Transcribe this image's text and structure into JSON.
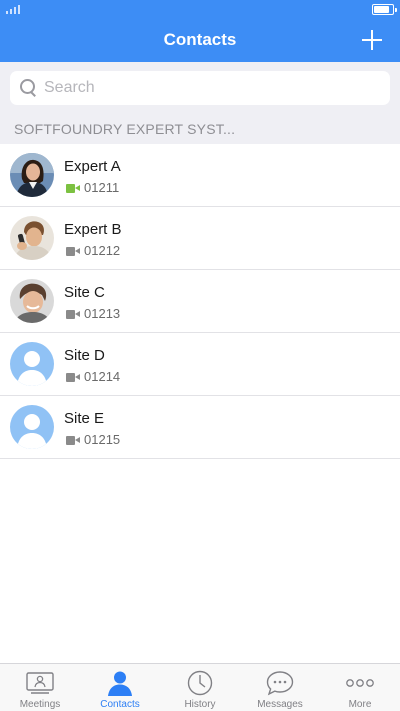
{
  "header": {
    "title": "Contacts",
    "add_icon": "plus-icon",
    "battery_level": 0.85,
    "signal_bars": 4
  },
  "search": {
    "placeholder": "Search",
    "value": ""
  },
  "section": {
    "label": "SOFTFOUNDRY EXPERT SYST..."
  },
  "contacts": [
    {
      "name": "Expert A",
      "number": "01211",
      "avatar": "photo-woman",
      "video_status": "online",
      "status_color": "#7cc141"
    },
    {
      "name": "Expert B",
      "number": "01212",
      "avatar": "photo-man-phone",
      "video_status": "offline",
      "status_color": "#8a8a8a"
    },
    {
      "name": "Site C",
      "number": "01213",
      "avatar": "photo-man-smile",
      "video_status": "offline",
      "status_color": "#8a8a8a"
    },
    {
      "name": "Site D",
      "number": "01214",
      "avatar": "default-person",
      "video_status": "offline",
      "status_color": "#8a8a8a"
    },
    {
      "name": "Site E",
      "number": "01215",
      "avatar": "default-person",
      "video_status": "offline",
      "status_color": "#8a8a8a"
    }
  ],
  "tabs": [
    {
      "label": "Meetings",
      "icon": "meetings-icon",
      "active": false
    },
    {
      "label": "Contacts",
      "icon": "person-icon",
      "active": true
    },
    {
      "label": "History",
      "icon": "clock-icon",
      "active": false
    },
    {
      "label": "Messages",
      "icon": "chat-bubble-icon",
      "active": false
    },
    {
      "label": "More",
      "icon": "more-dots-icon",
      "active": false
    }
  ],
  "colors": {
    "brand": "#3d8df5",
    "tab_active": "#2d7ff5",
    "tab_inactive": "#808085",
    "default_avatar_bg": "#90c2f5"
  }
}
